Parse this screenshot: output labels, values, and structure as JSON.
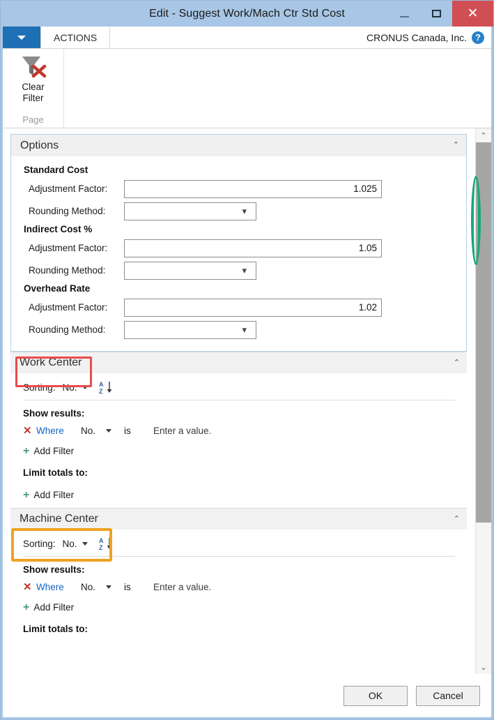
{
  "window": {
    "title": "Edit - Suggest Work/Mach Ctr Std Cost",
    "minimize_label": "—",
    "maximize_label": "",
    "close_label": "✕"
  },
  "ribbon": {
    "dropdown_label": "",
    "tab_label": "ACTIONS",
    "company": "CRONUS Canada, Inc.",
    "help_label": "?",
    "clear_filter_label": "Clear\nFilter",
    "clear_filter_line1": "Clear",
    "clear_filter_line2": "Filter",
    "group_name": "Page"
  },
  "options": {
    "header": "Options",
    "chevron": "⌃",
    "groups": [
      {
        "title": "Standard Cost",
        "adjustment_label": "Adjustment Factor:",
        "adjustment_value": "1.025",
        "rounding_label": "Rounding Method:",
        "rounding_value": ""
      },
      {
        "title": "Indirect Cost %",
        "adjustment_label": "Adjustment Factor:",
        "adjustment_value": "1.05",
        "rounding_label": "Rounding Method:",
        "rounding_value": ""
      },
      {
        "title": "Overhead Rate",
        "adjustment_label": "Adjustment Factor:",
        "adjustment_value": "1.02",
        "rounding_label": "Rounding Method:",
        "rounding_value": ""
      }
    ]
  },
  "work_center": {
    "header": "Work Center",
    "chevron": "⌃",
    "sorting_label": "Sorting:",
    "sorting_value": "No.",
    "show_results_label": "Show results:",
    "where_label": "Where",
    "field_name": "No.",
    "is_word": "is",
    "value_placeholder": "Enter a value.",
    "add_filter_label": "Add Filter",
    "limit_totals_label": "Limit totals to:",
    "limit_add_filter_label": "Add Filter",
    "remove_icon": "✕",
    "plus_icon": "+"
  },
  "machine_center": {
    "header": "Machine Center",
    "chevron": "⌃",
    "sorting_label": "Sorting:",
    "sorting_value": "No.",
    "show_results_label": "Show results:",
    "where_label": "Where",
    "field_name": "No.",
    "is_word": "is",
    "value_placeholder": "Enter a value.",
    "add_filter_label": "Add Filter",
    "limit_totals_label": "Limit totals to:",
    "remove_icon": "✕",
    "plus_icon": "+"
  },
  "scrollbar": {
    "up_arrow": "⌃",
    "down_arrow": "⌄"
  },
  "footer": {
    "ok_label": "OK",
    "cancel_label": "Cancel"
  },
  "annotations": {
    "work_center_highlight_color": "#ea4b4b",
    "machine_center_highlight_color": "#eda220",
    "scrollbar_highlight_color": "#18a877"
  }
}
